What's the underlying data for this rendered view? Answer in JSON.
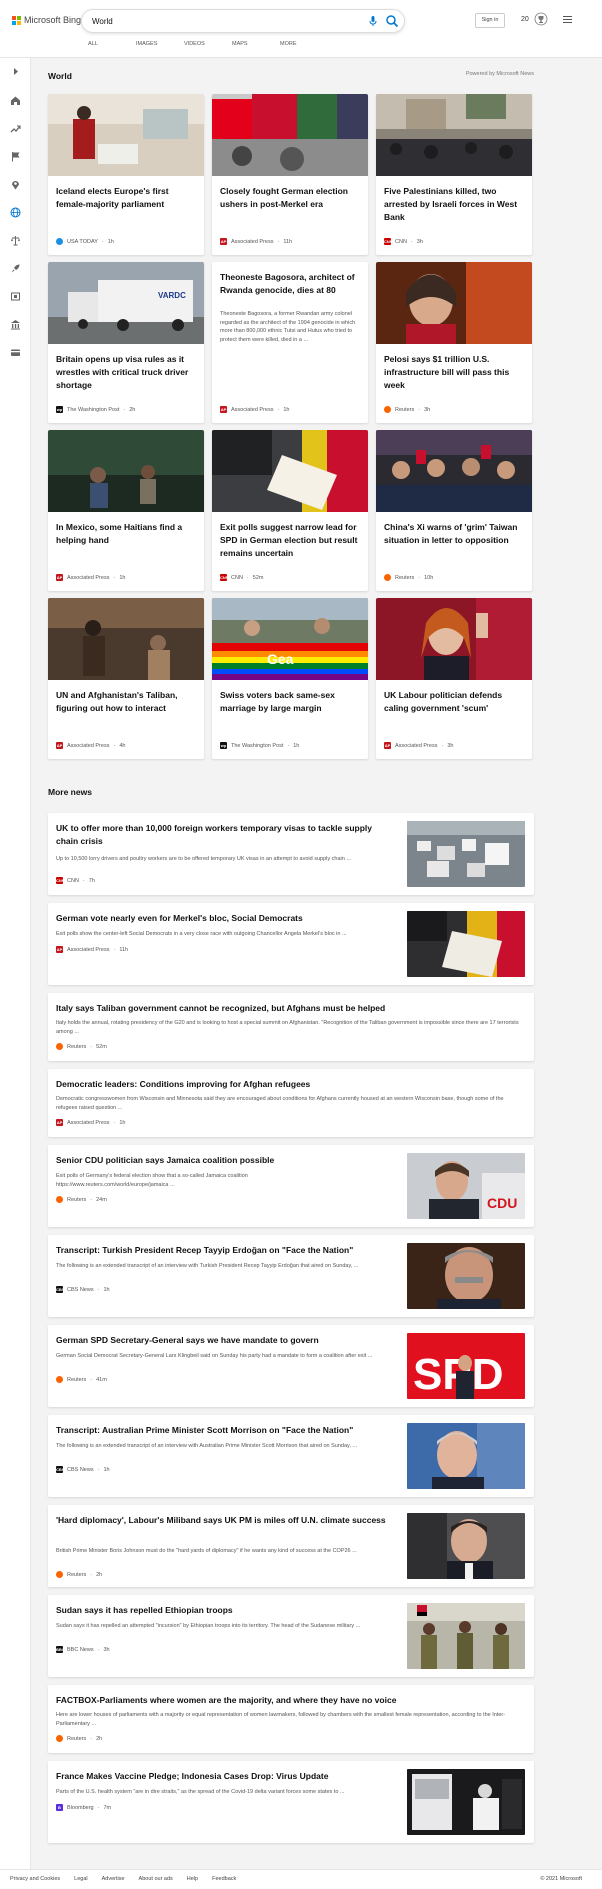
{
  "header": {
    "logo_text": "Microsoft Bing",
    "search_value": "World",
    "scopes": [
      "ALL",
      "IMAGES",
      "VIDEOS",
      "MAPS",
      "MORE"
    ],
    "signin_label": "Sign in",
    "rewards_points": "20",
    "accent_color": "#0078d4"
  },
  "world": {
    "title": "World",
    "powered_by": "Powered by Microsoft News",
    "cards": [
      {
        "title": "Iceland elects Europe's first female-majority parliament",
        "source": "USA TODAY",
        "time": "1h"
      },
      {
        "title": "Closely fought German election ushers in post-Merkel era",
        "source": "Associated Press",
        "time": "11h"
      },
      {
        "title": "Five Palestinians killed, two arrested by Israeli forces in West Bank",
        "source": "CNN",
        "time": "3h"
      },
      {
        "title": "Britain opens up visa rules as it wrestles with critical truck driver shortage",
        "source": "The Washington Post",
        "time": "2h"
      },
      {
        "title": "Theoneste Bagosora, architect of Rwanda genocide, dies at 80",
        "snippet": "Theoneste Bagosora, a former Rwandan army colonel regarded as the architect of the 1994 genocide in which more than 800,000 ethnic Tutsi and Hutus who tried to protect them were killed, died in a ...",
        "source": "Associated Press",
        "time": "1h"
      },
      {
        "title": "Pelosi says $1 trillion U.S. infrastructure bill will pass this week",
        "source": "Reuters",
        "time": "3h"
      },
      {
        "title": "In Mexico, some Haitians find a helping hand",
        "source": "Associated Press",
        "time": "1h"
      },
      {
        "title": "Exit polls suggest narrow lead for SPD in German election but result remains uncertain",
        "source": "CNN",
        "time": "52m"
      },
      {
        "title": "China's Xi warns of 'grim' Taiwan situation in letter to opposition",
        "source": "Reuters",
        "time": "10h"
      },
      {
        "title": "UN and Afghanistan's Taliban, figuring out how to interact",
        "source": "Associated Press",
        "time": "4h"
      },
      {
        "title": "Swiss voters back same-sex marriage by large margin",
        "source": "The Washington Post",
        "time": "1h"
      },
      {
        "title": "UK Labour politician defends caling government 'scum'",
        "source": "Associated Press",
        "time": "3h"
      }
    ]
  },
  "more": {
    "title": "More news",
    "items": [
      {
        "title": "UK to offer more than 10,000 foreign workers temporary visas to tackle supply chain crisis",
        "snippet": "Up to 10,500 lorry drivers and poultry workers are to be offered temporary UK visas in an attempt to avoid supply chain ...",
        "source": "CNN",
        "time": "7h"
      },
      {
        "title": "German vote nearly even for Merkel's bloc, Social Democrats",
        "snippet": "Exit polls show the center-left Social Democrats in a very close race with outgoing Chancellor Angela Merkel's bloc in ...",
        "source": "Associated Press",
        "time": "11h"
      },
      {
        "title": "Italy says Taliban government cannot be recognized, but Afghans must be helped",
        "snippet": "Italy holds the annual, rotating presidency of the G20 and is looking to host a special summit on Afghanistan. \"Recognition of the Taliban government is impossible since there are 17 terrorists among ...",
        "source": "Reuters",
        "time": "52m"
      },
      {
        "title": "Democratic leaders: Conditions improving for Afghan refugees",
        "snippet": "Democratic congresswomen from Wisconsin and Minnesota said they are encouraged about conditions for Afghans currently housed at an western Wisconsin base, though some of the refugees raised question ...",
        "source": "Associated Press",
        "time": "1h"
      },
      {
        "title": "Senior CDU politician says Jamaica coalition possible",
        "snippet": "Exit polls of Germany's federal election show that a so-called Jamaica coalition https://www.reuters.com/world/europe/jamaica ...",
        "source": "Reuters",
        "time": "24m"
      },
      {
        "title": "Transcript: Turkish President Recep Tayyip Erdoğan on \"Face the Nation\"",
        "snippet": "The following is an extended transcript of an interview with Turkish President Recep Tayyip Erdoğan that aired on Sunday, ...",
        "source": "CBS News",
        "time": "1h"
      },
      {
        "title": "German SPD Secretary-General says we have mandate to govern",
        "snippet": "German Social Democrat Secretary-General Lars Klingbeil said on Sunday his party had a mandate to form a coalition after exit ...",
        "source": "Reuters",
        "time": "41m"
      },
      {
        "title": "Transcript: Australian Prime Minister Scott Morrison on \"Face the Nation\"",
        "snippet": "The following is an extended transcript of an interview with Australian Prime Minister Scott Morrison that aired on Sunday, ...",
        "source": "CBS News",
        "time": "1h"
      },
      {
        "title": "'Hard diplomacy', Labour's Miliband says UK PM is miles off U.N. climate success",
        "snippet": "British Prime Minister Boris Johnson must do the \"hard yards of diplomacy\" if he wants any kind of success at the COP26 ...",
        "source": "Reuters",
        "time": "2h"
      },
      {
        "title": "Sudan says it has repelled Ethiopian troops",
        "snippet": "Sudan says it has repelled an attempted \"incursion\" by Ethiopian troops into its territory. The head of the Sudanese military ...",
        "source": "BBC News",
        "time": "3h"
      },
      {
        "title": "FACTBOX-Parliaments where women are the majority, and where they have no voice",
        "snippet": "Here are lower houses of parliaments with a majority or equal representation of women lawmakers, followed by chambers with the smallest female representation, according to the Inter-Parliamentary ...",
        "source": "Reuters",
        "time": "2h"
      },
      {
        "title": "France Makes Vaccine Pledge; Indonesia Cases Drop: Virus Update",
        "snippet": "Parts of the U.S. health system \"are in dire straits,\" as the spread of the Covid-19 delta variant forces some states to ...",
        "source": "Bloomberg",
        "time": "7m"
      }
    ]
  },
  "footer": {
    "links": [
      "Privacy and Cookies",
      "Legal",
      "Advertise",
      "About our ads",
      "Help",
      "Feedback"
    ],
    "copyright": "© 2021 Microsoft"
  }
}
